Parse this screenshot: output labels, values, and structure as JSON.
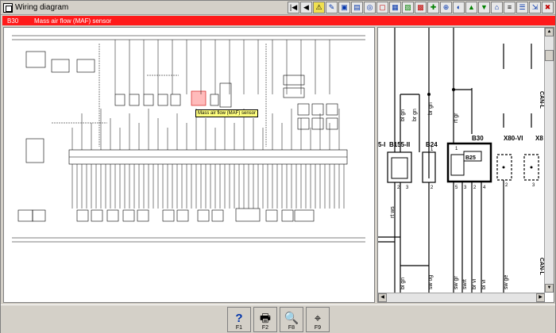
{
  "window": {
    "title": "Wiring diagram"
  },
  "toolbar": {
    "buttons": [
      "|◀",
      "◀",
      "⚠",
      "✎",
      "▣",
      "▤",
      "◎",
      "▢",
      "▦",
      "▨",
      "▩",
      "✚",
      "⊕",
      "◐",
      "▲",
      "▼",
      "⌂",
      "≡",
      "☰",
      "⇲",
      "✖"
    ]
  },
  "component_bar": {
    "code": "B30",
    "name": "Mass air flow (MAF) sensor"
  },
  "tooltip": {
    "text": "Mass air flow (MAF) sensor"
  },
  "detail": {
    "labels": {
      "b155": "B155-II",
      "b155_left": "5-I",
      "b24": "B24",
      "b30": "B30",
      "b25": "B25",
      "x80": "X80-VI",
      "x8_right": "X8",
      "w1": "bl gn",
      "w2": "br gn",
      "w3": "rt gr",
      "w4": "rt ws",
      "w5": "bl gn",
      "w6": "sw gr",
      "w7": "sw og",
      "w8": "swrt",
      "w9": "br vi",
      "w10": "bl vi",
      "w11": "sw ge",
      "can1": "CAN-L",
      "can2": "CAN-L",
      "pin1": "1",
      "pin2": "2",
      "pin3": "3",
      "pin4": "1",
      "pin5": "2",
      "pin6": "1",
      "pin7": "2",
      "pin8": "5",
      "pin9": "3",
      "pin10": "2",
      "pin11": "4",
      "pin12": "1",
      "pin13": "2",
      "pin14": "3"
    }
  },
  "function_keys": [
    {
      "key": "F1",
      "icon": "?"
    },
    {
      "key": "F2",
      "icon": "🖶"
    },
    {
      "key": "F8",
      "icon": "🔍"
    },
    {
      "key": "F9",
      "icon": "⌖"
    }
  ],
  "colors": {
    "accent": "#ff1a1a",
    "tooltip": "#ffff80"
  }
}
